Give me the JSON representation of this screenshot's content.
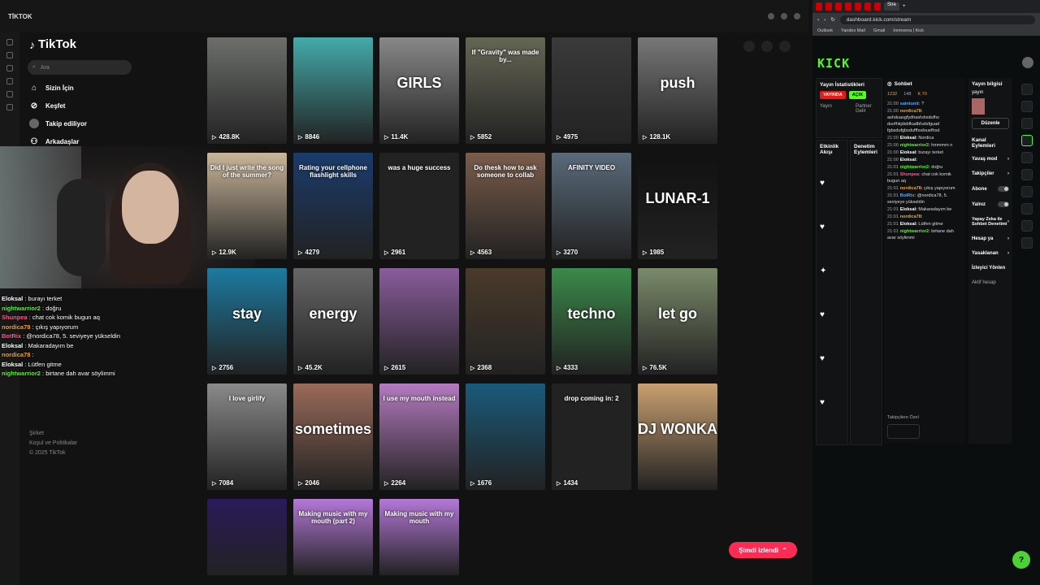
{
  "os_bar": {
    "app_title": "TİKTOK"
  },
  "tiktok": {
    "logo": "TikTok",
    "search_placeholder": "Ara",
    "nav": [
      {
        "label": "Sizin İçin",
        "icon": "home-icon"
      },
      {
        "label": "Keşfet",
        "icon": "compass-icon"
      },
      {
        "label": "Takip ediliyor",
        "icon": "avatar-icon"
      },
      {
        "label": "Arkadaşlar",
        "icon": "friends-icon"
      }
    ],
    "footer": [
      "Şirket",
      "Koşul ve Politikalar",
      "© 2025 TikTok"
    ],
    "now_watching": "Şimdi izlendi",
    "videos": [
      {
        "count": "428.8K",
        "caption": ""
      },
      {
        "count": "8846",
        "caption": ""
      },
      {
        "count": "11.4K",
        "caption": "GIRLS"
      },
      {
        "count": "5852",
        "caption": "If \"Gravity\" was made by..."
      },
      {
        "count": "4975",
        "caption": ""
      },
      {
        "count": "128.1K",
        "caption": "push"
      },
      {
        "count": "12.9K",
        "caption": "Did I just write the song of the summer?"
      },
      {
        "count": "4279",
        "caption": "Rating your cellphone flashlight skills"
      },
      {
        "count": "2961",
        "caption": "was a huge success"
      },
      {
        "count": "4563",
        "caption": "Do thesk how to ask someone to collab"
      },
      {
        "count": "3270",
        "caption": "AFINITY VIDEO"
      },
      {
        "count": "1985",
        "caption": "LUNAR-1"
      },
      {
        "count": "2756",
        "caption": "stay"
      },
      {
        "count": "45.2K",
        "caption": "energy"
      },
      {
        "count": "2615",
        "caption": ""
      },
      {
        "count": "2368",
        "caption": ""
      },
      {
        "count": "4333",
        "caption": "techno"
      },
      {
        "count": "76.5K",
        "caption": "let go"
      },
      {
        "count": "7084",
        "caption": "I love girlify"
      },
      {
        "count": "2046",
        "caption": "sometimes"
      },
      {
        "count": "2264",
        "caption": "I use my mouth instead"
      },
      {
        "count": "1676",
        "caption": ""
      },
      {
        "count": "1434",
        "caption": "drop coming in: 2"
      },
      {
        "count": "",
        "caption": "DJ WONKA"
      },
      {
        "count": "",
        "caption": ""
      },
      {
        "count": "",
        "caption": "Making music with my mouth (part 2)"
      },
      {
        "count": "",
        "caption": "Making music with my mouth"
      }
    ]
  },
  "overlay_chat": [
    {
      "user": "Eloksal",
      "text": ": burayı terket",
      "color": "#ffffff"
    },
    {
      "user": "nightwarrior2",
      "text": ": doğru",
      "color": "#53fc18"
    },
    {
      "user": "Shunpea",
      "text": ": chat cok komik bugun aq",
      "color": "#ff5c8a"
    },
    {
      "user": "nordica78",
      "text": ": çıkış yapıyorum",
      "color": "#f5a623"
    },
    {
      "user": "BotRix",
      "text": ": @nordica78, 5. seviyeye yükseldin",
      "color": "#ff5c8a"
    },
    {
      "user": "Eloksal",
      "text": ": Makaradayım be",
      "color": "#ffffff"
    },
    {
      "user": "nordica78",
      "text": ":",
      "color": "#f5a623"
    },
    {
      "user": "Eloksal",
      "text": ": Lütfen gitme",
      "color": "#ffffff"
    },
    {
      "user": "nightwarrior2",
      "text": ": birtane dah avar söylimmi",
      "color": "#53fc18"
    }
  ],
  "kick": {
    "url": "dashboard.kick.com/stream",
    "bookmarks": [
      "Outlook",
      "Yandex Mail",
      "Gmail",
      "Iremxena | Kick"
    ],
    "logo": "KICK",
    "stats_title": "Yayın İstatistikleri",
    "live_badge": "YAYINDA",
    "open_badge": "AÇIK",
    "stream_label": "Yayın",
    "partner_label": "Partner Gelir",
    "activity_title": "Etkinlik Akışı",
    "moderation_title": "Denetim Eylemleri",
    "chat_title": "Sohbet",
    "chat_stats": [
      "1232",
      "148",
      "K 70"
    ],
    "chat_messages": [
      {
        "ts": "21:00",
        "user": "saintunit",
        "text": "?",
        "color": "#55aaff"
      },
      {
        "ts": "21:00",
        "user": "nordica78",
        "text": "ashduasgfydhasfuhsdufhs duofhkjdsbfkadbfudsfguad fgbsdufgbsduffhsdouefhsd",
        "color": "#f5a623"
      },
      {
        "ts": "21:00",
        "user": "Eloksal",
        "text": "Nordica",
        "color": "#ffffff"
      },
      {
        "ts": "21:00",
        "user": "nightwarrior2",
        "text": "hmmmm n",
        "color": "#53fc18"
      },
      {
        "ts": "21:00",
        "user": "Eloksal",
        "text": "burayı terket",
        "color": "#ffffff"
      },
      {
        "ts": "21:00",
        "user": "Eloksal",
        "text": "",
        "color": "#ffffff"
      },
      {
        "ts": "21:01",
        "user": "nightwarrior2",
        "text": "doğru",
        "color": "#53fc18"
      },
      {
        "ts": "21:01",
        "user": "Shunpea",
        "text": "chat cok komik bugun aq",
        "color": "#ff5c8a"
      },
      {
        "ts": "21:01",
        "user": "nordica78",
        "text": "çıkış yapıyorum",
        "color": "#f5a623"
      },
      {
        "ts": "21:01",
        "user": "BotRix",
        "text": "@nordica78, 5. seviyeye yükseldin",
        "color": "#55aaff"
      },
      {
        "ts": "21:01",
        "user": "Eloksal",
        "text": "Makaradayım be",
        "color": "#ffffff"
      },
      {
        "ts": "21:01",
        "user": "nordica78",
        "text": "",
        "color": "#f5a623"
      },
      {
        "ts": "21:01",
        "user": "Eloksal",
        "text": "Lütfen gitme",
        "color": "#ffffff"
      },
      {
        "ts": "21:01",
        "user": "nightwarrior2",
        "text": "birtane dah avar söylimmi",
        "color": "#53fc18"
      }
    ],
    "follower_label": "Takipçilere Özel",
    "stream_info_title": "Yayın bilgisi",
    "stream_info_name": "yayın",
    "edit_btn": "Düzenle",
    "channel_actions": "Kanal Eylemleri",
    "actions": [
      "Yavaş mod",
      "Takipçiler",
      "Abone",
      "Yalnız",
      "Yapay Zeka ile Sohbet Denetimi",
      "Hesap ya",
      "Yasaklanan",
      "İzleyici Yönlen"
    ],
    "active_label": "Aktif hesap"
  }
}
